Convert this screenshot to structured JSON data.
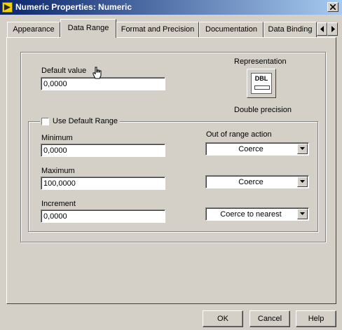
{
  "window": {
    "title": "Numeric Properties: Numeric",
    "icon": "labview-app-icon"
  },
  "tabs": [
    {
      "label": "Appearance",
      "active": false
    },
    {
      "label": "Data Range",
      "active": true
    },
    {
      "label": "Format and Precision",
      "active": false
    },
    {
      "label": "Documentation",
      "active": false
    },
    {
      "label": "Data Binding",
      "active": false
    }
  ],
  "default_value": {
    "label": "Default value",
    "value": "0,0000"
  },
  "representation": {
    "label": "Representation",
    "badge": "DBL",
    "caption": "Double precision"
  },
  "use_default_range": {
    "label": "Use Default Range",
    "checked": false
  },
  "range": {
    "minimum": {
      "label": "Minimum",
      "value": "0,0000"
    },
    "maximum": {
      "label": "Maximum",
      "value": "100,0000"
    },
    "increment": {
      "label": "Increment",
      "value": "0,0000"
    }
  },
  "out_of_range": {
    "label": "Out of range action",
    "minimum_action": "Coerce",
    "maximum_action": "Coerce",
    "increment_action": "Coerce to nearest"
  },
  "buttons": {
    "ok": "OK",
    "cancel": "Cancel",
    "help": "Help"
  }
}
